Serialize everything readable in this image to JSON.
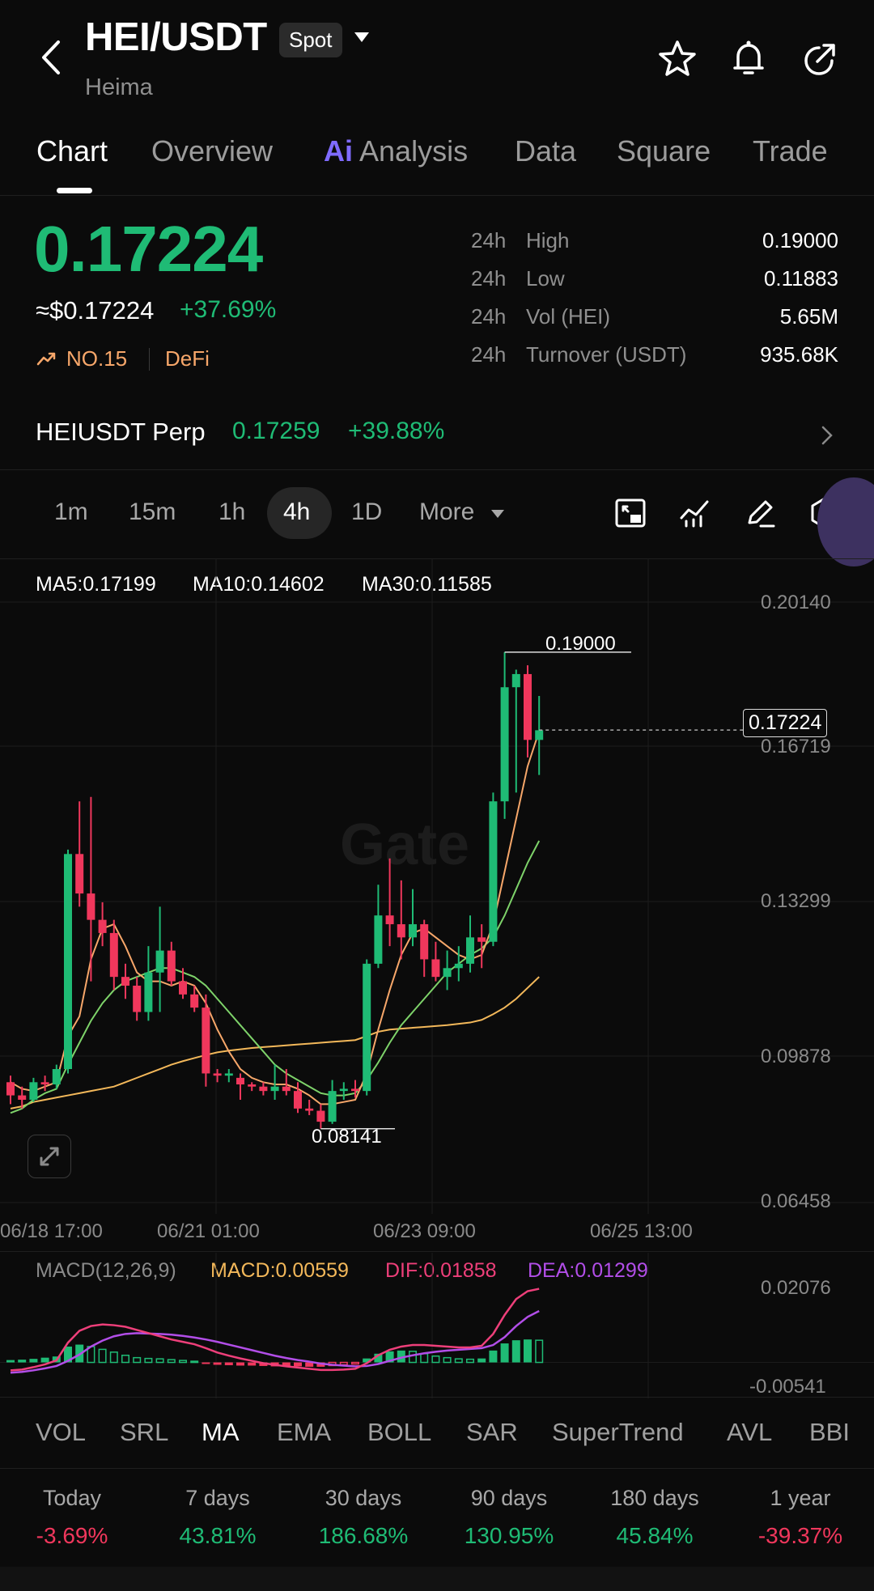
{
  "header": {
    "pair": "HEI/USDT",
    "market": "Spot",
    "name": "Heima"
  },
  "tabs": [
    {
      "label": "Chart"
    },
    {
      "label": "Overview"
    },
    {
      "label": "Analysis",
      "prefix": "Ai"
    },
    {
      "label": "Data"
    },
    {
      "label": "Square"
    },
    {
      "label": "Trade"
    }
  ],
  "price": {
    "last": "0.17224",
    "usd": "≈$0.17224",
    "change": "+37.69%",
    "rank": "NO.15",
    "category": "DeFi"
  },
  "stats": [
    {
      "period": "24h",
      "label": "High",
      "value": "0.19000"
    },
    {
      "period": "24h",
      "label": "Low",
      "value": "0.11883"
    },
    {
      "period": "24h",
      "label": "Vol (HEI)",
      "value": "5.65M"
    },
    {
      "period": "24h",
      "label": "Turnover (USDT)",
      "value": "935.68K"
    }
  ],
  "perp": {
    "name": "HEIUSDT Perp",
    "price": "0.17259",
    "change": "+39.88%"
  },
  "intervals": [
    "1m",
    "15m",
    "1h",
    "4h",
    "1D",
    "More"
  ],
  "active_interval": "4h",
  "ma_legend": [
    {
      "text": "MA5:0.17199",
      "color": "#f7a76a"
    },
    {
      "text": "MA10:0.14602",
      "color": "#7ed36a"
    },
    {
      "text": "MA30:0.11585",
      "color": "#f3b85a"
    }
  ],
  "price_axis": [
    "0.20140",
    "0.16719",
    "0.13299",
    "0.09878",
    "0.06458"
  ],
  "current_price_tag": "0.17224",
  "high_marker": "0.19000",
  "low_marker": "0.08141",
  "watermark": "Gate",
  "date_axis": [
    "06/18 17:00",
    "06/21 01:00",
    "06/23 09:00",
    "06/25 13:00"
  ],
  "macd_legend": [
    {
      "text": "MACD(12,26,9)",
      "color": "#8a8a8a"
    },
    {
      "text": "MACD:0.00559",
      "color": "#f3b85a"
    },
    {
      "text": "DIF:0.01858",
      "color": "#ee3f7a"
    },
    {
      "text": "DEA:0.01299",
      "color": "#b24ee8"
    }
  ],
  "macd_axis": [
    "0.02076",
    "-0.00541"
  ],
  "indicators": [
    "VOL",
    "SRL",
    "MA",
    "EMA",
    "BOLL",
    "SAR",
    "SuperTrend",
    "AVL",
    "BBI"
  ],
  "active_indicator": "MA",
  "performance": [
    {
      "label": "Today",
      "value": "-3.69%",
      "dir": "down"
    },
    {
      "label": "7 days",
      "value": "43.81%",
      "dir": "up"
    },
    {
      "label": "30 days",
      "value": "186.68%",
      "dir": "up"
    },
    {
      "label": "90 days",
      "value": "130.95%",
      "dir": "up"
    },
    {
      "label": "180 days",
      "value": "45.84%",
      "dir": "up"
    },
    {
      "label": "1 year",
      "value": "-39.37%",
      "dir": "down"
    }
  ],
  "colors": {
    "up": "#1fbb75",
    "down": "#f0375c",
    "accent_ai": "#7f6bff"
  },
  "chart_data": {
    "type": "candlestick",
    "ylim": [
      0.06458,
      0.2014
    ],
    "candles": [
      [
        0.092,
        0.0935,
        0.087,
        0.089
      ],
      [
        0.089,
        0.091,
        0.086,
        0.088
      ],
      [
        0.088,
        0.093,
        0.0875,
        0.092
      ],
      [
        0.092,
        0.0935,
        0.09,
        0.0915
      ],
      [
        0.0915,
        0.096,
        0.0905,
        0.095
      ],
      [
        0.095,
        0.145,
        0.094,
        0.144
      ],
      [
        0.144,
        0.156,
        0.132,
        0.135
      ],
      [
        0.135,
        0.157,
        0.115,
        0.129
      ],
      [
        0.129,
        0.133,
        0.123,
        0.126
      ],
      [
        0.126,
        0.129,
        0.113,
        0.116
      ],
      [
        0.116,
        0.119,
        0.111,
        0.114
      ],
      [
        0.114,
        0.116,
        0.106,
        0.108
      ],
      [
        0.108,
        0.123,
        0.106,
        0.117
      ],
      [
        0.117,
        0.132,
        0.108,
        0.122
      ],
      [
        0.122,
        0.124,
        0.114,
        0.115
      ],
      [
        0.115,
        0.118,
        0.111,
        0.112
      ],
      [
        0.112,
        0.114,
        0.108,
        0.109
      ],
      [
        0.109,
        0.112,
        0.091,
        0.094
      ],
      [
        0.094,
        0.095,
        0.092,
        0.0935
      ],
      [
        0.0935,
        0.095,
        0.092,
        0.094
      ],
      [
        0.093,
        0.094,
        0.088,
        0.0915
      ],
      [
        0.0915,
        0.092,
        0.09,
        0.091
      ],
      [
        0.091,
        0.092,
        0.089,
        0.09
      ],
      [
        0.09,
        0.096,
        0.088,
        0.091
      ],
      [
        0.091,
        0.095,
        0.089,
        0.09
      ],
      [
        0.09,
        0.092,
        0.085,
        0.086
      ],
      [
        0.086,
        0.088,
        0.0845,
        0.0855
      ],
      [
        0.0855,
        0.087,
        0.0814,
        0.083
      ],
      [
        0.083,
        0.0925,
        0.0825,
        0.09
      ],
      [
        0.09,
        0.092,
        0.088,
        0.0905
      ],
      [
        0.0905,
        0.0925,
        0.0885,
        0.09
      ],
      [
        0.09,
        0.12,
        0.089,
        0.119
      ],
      [
        0.119,
        0.137,
        0.118,
        0.13
      ],
      [
        0.13,
        0.143,
        0.123,
        0.128
      ],
      [
        0.128,
        0.138,
        0.12,
        0.125
      ],
      [
        0.125,
        0.136,
        0.123,
        0.128
      ],
      [
        0.128,
        0.129,
        0.116,
        0.12
      ],
      [
        0.12,
        0.124,
        0.115,
        0.116
      ],
      [
        0.116,
        0.122,
        0.113,
        0.118
      ],
      [
        0.118,
        0.123,
        0.115,
        0.119
      ],
      [
        0.119,
        0.13,
        0.117,
        0.125
      ],
      [
        0.125,
        0.128,
        0.118,
        0.124
      ],
      [
        0.124,
        0.158,
        0.123,
        0.156
      ],
      [
        0.156,
        0.19,
        0.152,
        0.182
      ],
      [
        0.182,
        0.186,
        0.158,
        0.185
      ],
      [
        0.185,
        0.187,
        0.166,
        0.17
      ],
      [
        0.17,
        0.18,
        0.162,
        0.1722
      ]
    ],
    "ma5": [
      0.092,
      0.0905,
      0.09,
      0.091,
      0.092,
      0.1025,
      0.107,
      0.12,
      0.127,
      0.128,
      0.123,
      0.117,
      0.115,
      0.115,
      0.114,
      0.115,
      0.114,
      0.11,
      0.104,
      0.099,
      0.095,
      0.093,
      0.092,
      0.0915,
      0.0915,
      0.0905,
      0.089,
      0.087,
      0.087,
      0.0875,
      0.088,
      0.094,
      0.104,
      0.113,
      0.121,
      0.126,
      0.127,
      0.125,
      0.123,
      0.121,
      0.12,
      0.121,
      0.128,
      0.14,
      0.152,
      0.164,
      0.172
    ],
    "ma10": [
      0.085,
      0.086,
      0.088,
      0.0895,
      0.0905,
      0.096,
      0.101,
      0.106,
      0.11,
      0.113,
      0.115,
      0.116,
      0.117,
      0.118,
      0.118,
      0.117,
      0.116,
      0.114,
      0.111,
      0.108,
      0.105,
      0.102,
      0.099,
      0.096,
      0.094,
      0.0925,
      0.091,
      0.0895,
      0.089,
      0.089,
      0.0895,
      0.0925,
      0.0965,
      0.101,
      0.105,
      0.108,
      0.111,
      0.114,
      0.117,
      0.119,
      0.121,
      0.1225,
      0.125,
      0.13,
      0.136,
      0.142,
      0.147
    ],
    "ma30": [
      0.086,
      0.0865,
      0.0875,
      0.088,
      0.0885,
      0.089,
      0.0895,
      0.09,
      0.0905,
      0.091,
      0.092,
      0.093,
      0.094,
      0.095,
      0.096,
      0.0968,
      0.0975,
      0.0982,
      0.0988,
      0.0992,
      0.0995,
      0.0998,
      0.1,
      0.1002,
      0.1004,
      0.1006,
      0.1008,
      0.101,
      0.1012,
      0.1014,
      0.1016,
      0.1025,
      0.1035,
      0.104,
      0.1042,
      0.1044,
      0.1046,
      0.1048,
      0.105,
      0.1053,
      0.1056,
      0.1062,
      0.1075,
      0.109,
      0.111,
      0.1135,
      0.116
    ],
    "macd_ylim": [
      -0.00541,
      0.02076
    ],
    "macd_hist": [
      0.0006,
      0.0007,
      0.0009,
      0.0012,
      0.0015,
      0.004,
      0.0045,
      0.004,
      0.0033,
      0.0026,
      0.0018,
      0.0012,
      0.001,
      0.0009,
      0.0007,
      0.0005,
      0.0003,
      -0.0004,
      -0.0006,
      -0.0007,
      -0.0008,
      -0.0008,
      -0.0009,
      -0.001,
      -0.001,
      -0.001,
      -0.0011,
      -0.0011,
      -0.0008,
      -0.0006,
      -0.0004,
      0.001,
      0.0022,
      0.0028,
      0.003,
      0.0028,
      0.0022,
      0.0016,
      0.0012,
      0.0009,
      0.0008,
      0.001,
      0.003,
      0.0048,
      0.0056,
      0.0058,
      0.0056
    ],
    "dif": [
      -0.002,
      -0.0018,
      -0.0012,
      -0.0005,
      0.0005,
      0.005,
      0.008,
      0.0092,
      0.0096,
      0.0094,
      0.009,
      0.0082,
      0.0074,
      0.0066,
      0.0058,
      0.0052,
      0.0046,
      0.0036,
      0.0025,
      0.0017,
      0.001,
      0.0004,
      -0.0002,
      -0.0006,
      -0.001,
      -0.0013,
      -0.0016,
      -0.0019,
      -0.0019,
      -0.0018,
      -0.0016,
      -0.0002,
      0.0018,
      0.0032,
      0.004,
      0.0044,
      0.0044,
      0.0042,
      0.004,
      0.0038,
      0.0038,
      0.0042,
      0.0072,
      0.012,
      0.016,
      0.018,
      0.0186
    ],
    "dea": [
      -0.0026,
      -0.0024,
      -0.002,
      -0.0015,
      -0.0009,
      0.0004,
      0.002,
      0.004,
      0.0055,
      0.0066,
      0.0072,
      0.0074,
      0.0073,
      0.0072,
      0.007,
      0.0067,
      0.0063,
      0.0058,
      0.0052,
      0.0045,
      0.0038,
      0.0031,
      0.0024,
      0.0017,
      0.0011,
      0.0006,
      0.0002,
      -0.0003,
      -0.0006,
      -0.0008,
      -0.001,
      -0.0009,
      -0.0004,
      0.0004,
      0.0012,
      0.0018,
      0.0023,
      0.0027,
      0.003,
      0.0032,
      0.0034,
      0.0036,
      0.0044,
      0.0064,
      0.0092,
      0.0115,
      0.013
    ]
  }
}
